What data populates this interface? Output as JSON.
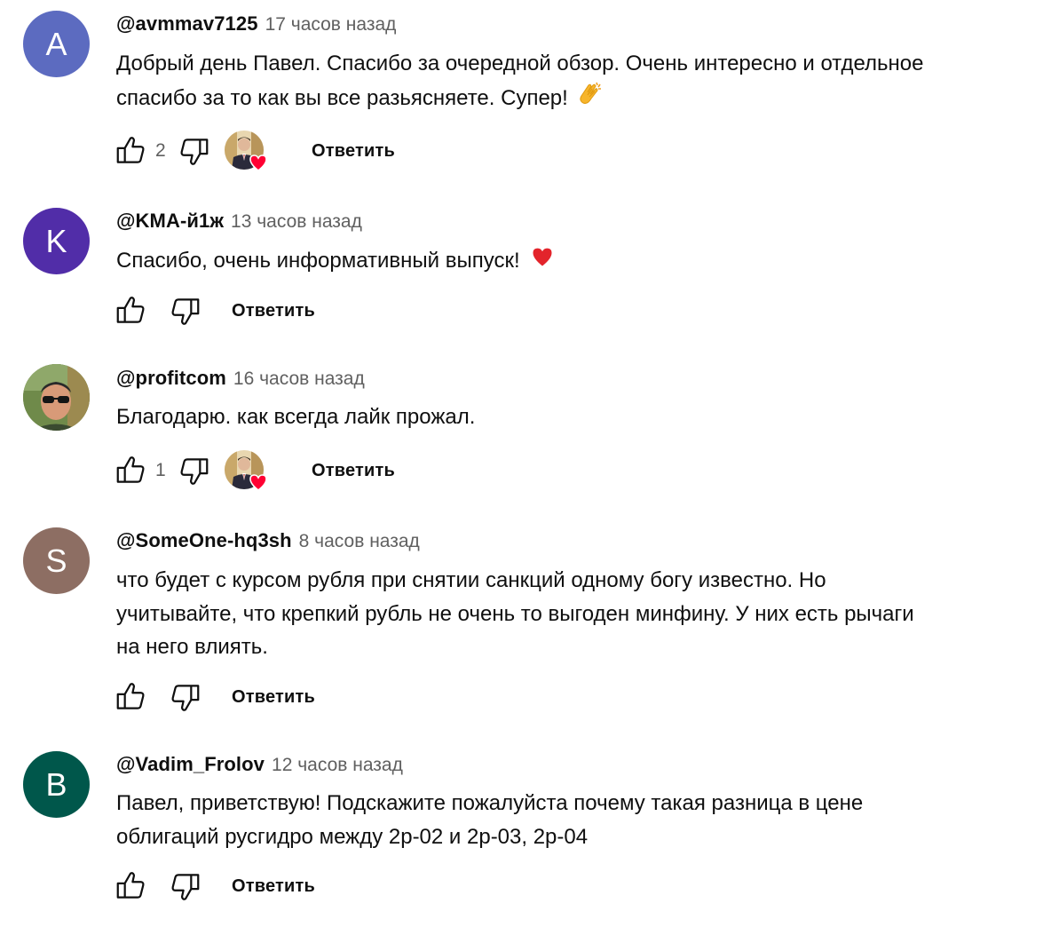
{
  "colors": {
    "text_primary": "#0f0f0f",
    "text_secondary": "#606060",
    "heart_red": "#ff0033"
  },
  "comments": [
    {
      "author": "@avmmav7125",
      "time": "17 часов назад",
      "avatar_letter": "A",
      "avatar_color": "#5c6bc0",
      "text_lines": [
        "Добрый день Павел. Спасибо за очередной обзор. Очень интересно и отдельное",
        "спасибо за то как вы все разьясняете. Супер!"
      ],
      "emoji": "clapping-hands-icon",
      "likes": "2",
      "creator_heart": true,
      "reply_label": "Ответить"
    },
    {
      "author": "@KMA-й1ж",
      "time": "13 часов назад",
      "avatar_letter": "K",
      "avatar_color": "#512da8",
      "text_lines": [
        "Спасибо, очень информативный выпуск!"
      ],
      "emoji": "red-heart-icon",
      "likes": "",
      "creator_heart": false,
      "reply_label": "Ответить"
    },
    {
      "author": "@profitcom",
      "time": "16 часов назад",
      "avatar_letter": "",
      "avatar_color": "#7a8a5a",
      "text_lines": [
        "Благодарю. как всегда лайк прожал."
      ],
      "emoji": "",
      "likes": "1",
      "creator_heart": true,
      "reply_label": "Ответить"
    },
    {
      "author": "@SomeOne-hq3sh",
      "time": "8 часов назад",
      "avatar_letter": "S",
      "avatar_color": "#8d6e63",
      "text_lines": [
        "что будет с курсом рубля при снятии санкций одному богу известно. Но",
        "учитывайте, что крепкий рубль не очень то выгоден минфину. У них есть рычаги",
        "на него влиять."
      ],
      "emoji": "",
      "likes": "",
      "creator_heart": false,
      "reply_label": "Ответить"
    },
    {
      "author": "@Vadim_Frolov",
      "time": "12 часов назад",
      "avatar_letter": "B",
      "avatar_color": "#00574b",
      "text_lines": [
        "Павел, приветствую! Подскажите пожалуйста почему такая разница в цене",
        "облигаций русгидро между 2р-02 и 2р-03, 2р-04"
      ],
      "emoji": "",
      "likes": "",
      "creator_heart": false,
      "reply_label": "Ответить"
    }
  ]
}
